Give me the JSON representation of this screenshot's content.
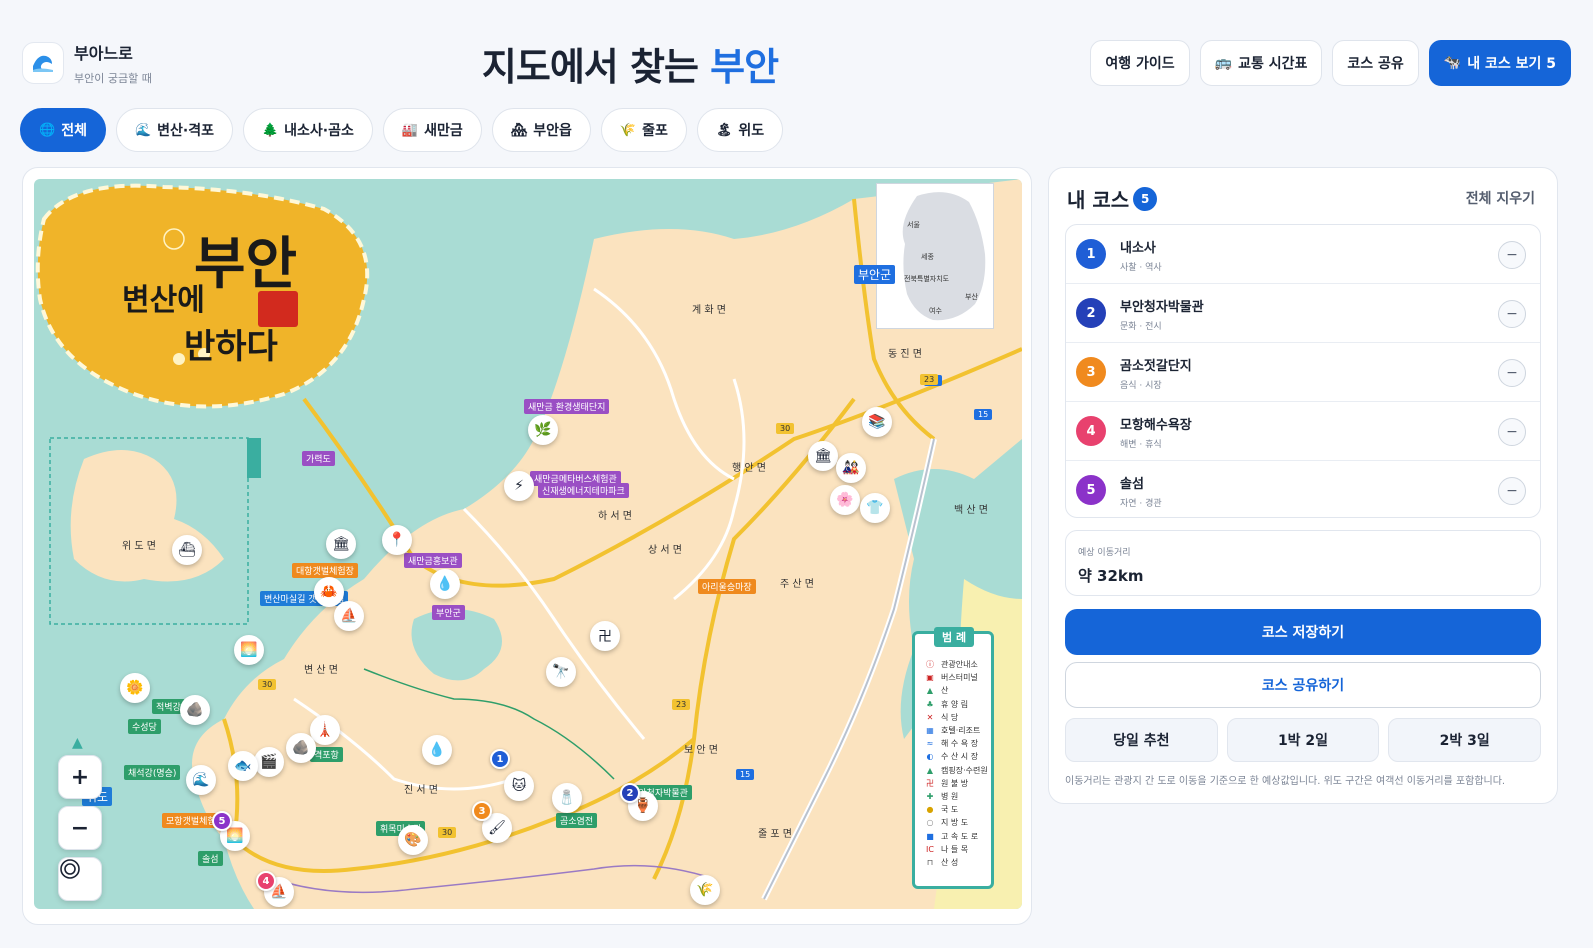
{
  "brand": {
    "name": "부아느로",
    "subtitle": "부안이 궁금할 때",
    "logo_icon": "wave-icon"
  },
  "page_title": {
    "main": "지도에서 찾는 ",
    "accent": "부안"
  },
  "header_actions": [
    {
      "label": "여행 가이드",
      "icon": ""
    },
    {
      "label": "교통 시간표",
      "icon": "bus-icon"
    },
    {
      "label": "코스 공유",
      "icon": ""
    },
    {
      "label": "내 코스 보기 5",
      "icon": "cow-icon"
    }
  ],
  "filters": [
    {
      "label": "전체",
      "icon": "🌐",
      "active": true
    },
    {
      "label": "변산·격포",
      "icon": "🌊",
      "active": false
    },
    {
      "label": "내소사·곰소",
      "icon": "🌲",
      "active": false
    },
    {
      "label": "새만금",
      "icon": "🏭",
      "active": false
    },
    {
      "label": "부안읍",
      "icon": "🏘",
      "active": false
    },
    {
      "label": "줄포",
      "icon": "🌾",
      "active": false
    },
    {
      "label": "위도",
      "icon": "🏝",
      "active": false
    }
  ],
  "map": {
    "emblem": {
      "line1": "부안",
      "line2": "변산에",
      "line3": "반하다"
    },
    "inset": {
      "region_tag": "부안군",
      "region_name": "전북특별자치도",
      "cities": [
        "서울",
        "세종",
        "부산",
        "여수"
      ]
    },
    "legend": {
      "title": "범 례",
      "items": [
        "관광안내소",
        "버스터미널",
        "산",
        "휴 양 림",
        "식 당",
        "호텔·리조트",
        "해 수 욕 장",
        "수 산 시 장",
        "캠핑장·수련원",
        "원 불 방",
        "병 원",
        "국 도",
        "지 방 도",
        "고 속 도 로",
        "나 들 목",
        "산 성"
      ]
    },
    "region_labels": [
      "계 화 면",
      "동 진 면",
      "행 안 면",
      "하 서 면",
      "상 서 면",
      "주 산 면",
      "변 산 면",
      "보 안 면",
      "진 서 면",
      "줄 포 면",
      "백 산 면",
      "위 도 면"
    ],
    "place_tags": [
      {
        "text": "새만금 환경생태단지",
        "color": "purple"
      },
      {
        "text": "새만금메타버스체험관",
        "color": "purple"
      },
      {
        "text": "신재생에너지테마파크",
        "color": "purple"
      },
      {
        "text": "새만금홍보관",
        "color": "purple"
      },
      {
        "text": "부안군",
        "color": "purple"
      },
      {
        "text": "가력도",
        "color": "purple"
      },
      {
        "text": "대항갯벌체험장",
        "color": "orange"
      },
      {
        "text": "아리울승마장",
        "color": "orange"
      },
      {
        "text": "수성당",
        "color": "green"
      },
      {
        "text": "채석강(명승)",
        "color": "green"
      },
      {
        "text": "적벽강",
        "color": "green"
      },
      {
        "text": "격포항",
        "color": "green"
      },
      {
        "text": "곰소염전",
        "color": "green"
      },
      {
        "text": "모항갯벌체험장",
        "color": "orange"
      },
      {
        "text": "위도",
        "color": "blue"
      },
      {
        "text": "솔섬",
        "color": "green"
      },
      {
        "text": "휘목미술관",
        "color": "green"
      },
      {
        "text": "부안청자박물관",
        "color": "green"
      },
      {
        "text": "변산마실길 갯벌 체험",
        "color": "blue"
      }
    ],
    "route_numbers": [
      "1",
      "2",
      "3",
      "4",
      "5"
    ],
    "route_colors": [
      "#1f5ed6",
      "#2440b8",
      "#f08a1e",
      "#e8416e",
      "#8b32c9"
    ],
    "road_badges": [
      "30",
      "23",
      "15",
      "30",
      "30",
      "23",
      "15"
    ],
    "controls": {
      "zoom_in": "+",
      "zoom_out": "−",
      "locate_icon": "target-icon"
    }
  },
  "side_panel": {
    "title": "내 코스",
    "count": "5",
    "clear_label": "전체 지우기",
    "course": [
      {
        "num": "1",
        "name": "내소사",
        "category": "사찰 · 역사",
        "color": "#1f5ed6"
      },
      {
        "num": "2",
        "name": "부안청자박물관",
        "category": "문화 · 전시",
        "color": "#2440b8"
      },
      {
        "num": "3",
        "name": "곰소젓갈단지",
        "category": "음식 · 시장",
        "color": "#f08a1e"
      },
      {
        "num": "4",
        "name": "모항해수욕장",
        "category": "해변 · 휴식",
        "color": "#e8416e"
      },
      {
        "num": "5",
        "name": "솔섬",
        "category": "자연 · 경관",
        "color": "#8b32c9"
      }
    ],
    "remove_label": "−",
    "distance_label": "예상 이동거리",
    "distance_value": "약 32km",
    "save_label": "코스 저장하기",
    "share_label": "코스 공유하기",
    "presets": [
      "당일 추천",
      "1박 2일",
      "2박 3일"
    ],
    "note": "이동거리는 관광지 간 도로 이동을 기준으로 한 예상값입니다. 위도 구간은 여객선 이동거리를 포함합니다."
  }
}
